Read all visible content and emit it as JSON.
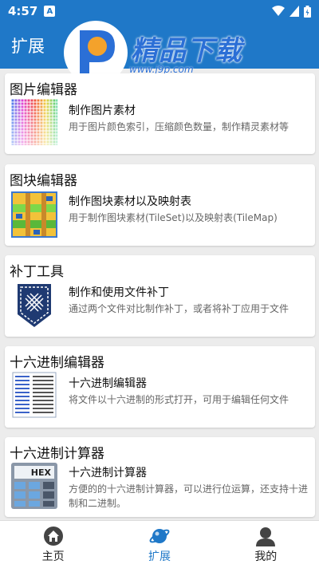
{
  "status_bar": {
    "time": "4:57",
    "notif_letter": "A"
  },
  "app_bar": {
    "title": "扩展"
  },
  "watermark": {
    "text": "精品下载",
    "url": "www.j9p.com"
  },
  "cards": [
    {
      "title": "图片编辑器",
      "subtitle": "制作图片素材",
      "description": "用于图片颜色索引，压缩颜色数量，制作精灵素材等",
      "icon": "palette-grid-icon"
    },
    {
      "title": "图块编辑器",
      "subtitle": "制作图块素材以及映射表",
      "description": "用于制作图块素材(TileSet)以及映射表(TileMap)",
      "icon": "tileset-icon"
    },
    {
      "title": "补丁工具",
      "subtitle": "制作和使用文件补丁",
      "description": "通过两个文件对比制作补丁，或者将补丁应用于文件",
      "icon": "patch-icon"
    },
    {
      "title": "十六进制编辑器",
      "subtitle": "十六进制编辑器",
      "description": "将文件以十六进制的形式打开，可用于编辑任何文件",
      "icon": "hex-document-icon"
    },
    {
      "title": "十六进制计算器",
      "subtitle": "十六进制计算器",
      "description": "方便的的十六进制计算器，可以进行位运算，还支持十进制和二进制。",
      "icon": "hex-calculator-icon",
      "icon_label": "HEX"
    }
  ],
  "bottom_nav": [
    {
      "label": "主页",
      "icon": "home-icon",
      "active": false
    },
    {
      "label": "扩展",
      "icon": "planet-icon",
      "active": true
    },
    {
      "label": "我的",
      "icon": "profile-icon",
      "active": false
    }
  ],
  "colors": {
    "primary": "#1f78c8",
    "background": "#ececec"
  }
}
